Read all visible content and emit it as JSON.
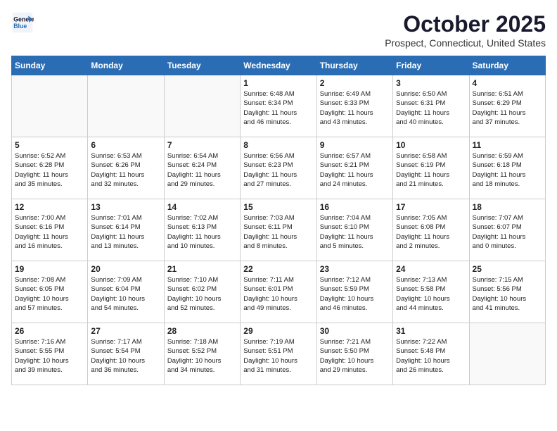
{
  "header": {
    "logo_line1": "General",
    "logo_line2": "Blue",
    "month": "October 2025",
    "location": "Prospect, Connecticut, United States"
  },
  "days_of_week": [
    "Sunday",
    "Monday",
    "Tuesday",
    "Wednesday",
    "Thursday",
    "Friday",
    "Saturday"
  ],
  "weeks": [
    [
      {
        "day": "",
        "info": ""
      },
      {
        "day": "",
        "info": ""
      },
      {
        "day": "",
        "info": ""
      },
      {
        "day": "1",
        "info": "Sunrise: 6:48 AM\nSunset: 6:34 PM\nDaylight: 11 hours\nand 46 minutes."
      },
      {
        "day": "2",
        "info": "Sunrise: 6:49 AM\nSunset: 6:33 PM\nDaylight: 11 hours\nand 43 minutes."
      },
      {
        "day": "3",
        "info": "Sunrise: 6:50 AM\nSunset: 6:31 PM\nDaylight: 11 hours\nand 40 minutes."
      },
      {
        "day": "4",
        "info": "Sunrise: 6:51 AM\nSunset: 6:29 PM\nDaylight: 11 hours\nand 37 minutes."
      }
    ],
    [
      {
        "day": "5",
        "info": "Sunrise: 6:52 AM\nSunset: 6:28 PM\nDaylight: 11 hours\nand 35 minutes."
      },
      {
        "day": "6",
        "info": "Sunrise: 6:53 AM\nSunset: 6:26 PM\nDaylight: 11 hours\nand 32 minutes."
      },
      {
        "day": "7",
        "info": "Sunrise: 6:54 AM\nSunset: 6:24 PM\nDaylight: 11 hours\nand 29 minutes."
      },
      {
        "day": "8",
        "info": "Sunrise: 6:56 AM\nSunset: 6:23 PM\nDaylight: 11 hours\nand 27 minutes."
      },
      {
        "day": "9",
        "info": "Sunrise: 6:57 AM\nSunset: 6:21 PM\nDaylight: 11 hours\nand 24 minutes."
      },
      {
        "day": "10",
        "info": "Sunrise: 6:58 AM\nSunset: 6:19 PM\nDaylight: 11 hours\nand 21 minutes."
      },
      {
        "day": "11",
        "info": "Sunrise: 6:59 AM\nSunset: 6:18 PM\nDaylight: 11 hours\nand 18 minutes."
      }
    ],
    [
      {
        "day": "12",
        "info": "Sunrise: 7:00 AM\nSunset: 6:16 PM\nDaylight: 11 hours\nand 16 minutes."
      },
      {
        "day": "13",
        "info": "Sunrise: 7:01 AM\nSunset: 6:14 PM\nDaylight: 11 hours\nand 13 minutes."
      },
      {
        "day": "14",
        "info": "Sunrise: 7:02 AM\nSunset: 6:13 PM\nDaylight: 11 hours\nand 10 minutes."
      },
      {
        "day": "15",
        "info": "Sunrise: 7:03 AM\nSunset: 6:11 PM\nDaylight: 11 hours\nand 8 minutes."
      },
      {
        "day": "16",
        "info": "Sunrise: 7:04 AM\nSunset: 6:10 PM\nDaylight: 11 hours\nand 5 minutes."
      },
      {
        "day": "17",
        "info": "Sunrise: 7:05 AM\nSunset: 6:08 PM\nDaylight: 11 hours\nand 2 minutes."
      },
      {
        "day": "18",
        "info": "Sunrise: 7:07 AM\nSunset: 6:07 PM\nDaylight: 11 hours\nand 0 minutes."
      }
    ],
    [
      {
        "day": "19",
        "info": "Sunrise: 7:08 AM\nSunset: 6:05 PM\nDaylight: 10 hours\nand 57 minutes."
      },
      {
        "day": "20",
        "info": "Sunrise: 7:09 AM\nSunset: 6:04 PM\nDaylight: 10 hours\nand 54 minutes."
      },
      {
        "day": "21",
        "info": "Sunrise: 7:10 AM\nSunset: 6:02 PM\nDaylight: 10 hours\nand 52 minutes."
      },
      {
        "day": "22",
        "info": "Sunrise: 7:11 AM\nSunset: 6:01 PM\nDaylight: 10 hours\nand 49 minutes."
      },
      {
        "day": "23",
        "info": "Sunrise: 7:12 AM\nSunset: 5:59 PM\nDaylight: 10 hours\nand 46 minutes."
      },
      {
        "day": "24",
        "info": "Sunrise: 7:13 AM\nSunset: 5:58 PM\nDaylight: 10 hours\nand 44 minutes."
      },
      {
        "day": "25",
        "info": "Sunrise: 7:15 AM\nSunset: 5:56 PM\nDaylight: 10 hours\nand 41 minutes."
      }
    ],
    [
      {
        "day": "26",
        "info": "Sunrise: 7:16 AM\nSunset: 5:55 PM\nDaylight: 10 hours\nand 39 minutes."
      },
      {
        "day": "27",
        "info": "Sunrise: 7:17 AM\nSunset: 5:54 PM\nDaylight: 10 hours\nand 36 minutes."
      },
      {
        "day": "28",
        "info": "Sunrise: 7:18 AM\nSunset: 5:52 PM\nDaylight: 10 hours\nand 34 minutes."
      },
      {
        "day": "29",
        "info": "Sunrise: 7:19 AM\nSunset: 5:51 PM\nDaylight: 10 hours\nand 31 minutes."
      },
      {
        "day": "30",
        "info": "Sunrise: 7:21 AM\nSunset: 5:50 PM\nDaylight: 10 hours\nand 29 minutes."
      },
      {
        "day": "31",
        "info": "Sunrise: 7:22 AM\nSunset: 5:48 PM\nDaylight: 10 hours\nand 26 minutes."
      },
      {
        "day": "",
        "info": ""
      }
    ]
  ]
}
